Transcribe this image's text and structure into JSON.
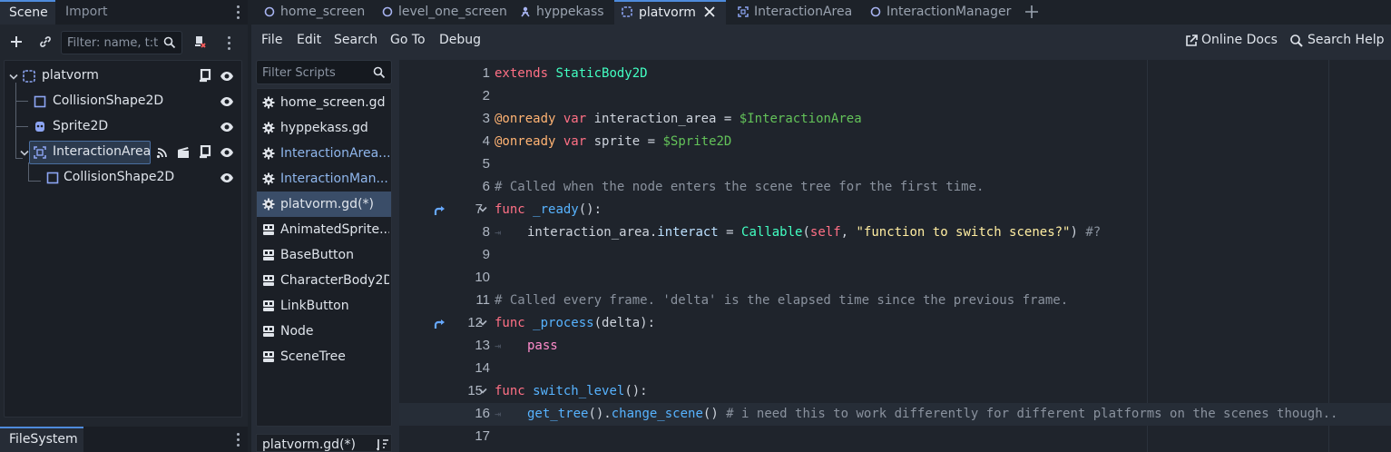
{
  "left_dock": {
    "tabs": [
      "Scene",
      "Import"
    ],
    "filter_placeholder": "Filter: name, t:t",
    "tree": [
      {
        "label": "platvorm",
        "icon": "static-body-icon"
      },
      {
        "label": "CollisionShape2D",
        "icon": "collision-shape-icon"
      },
      {
        "label": "Sprite2D",
        "icon": "sprite-icon"
      },
      {
        "label": "InteractionArea",
        "icon": "area-icon"
      },
      {
        "label": "CollisionShape2D",
        "icon": "collision-shape-icon"
      }
    ],
    "bottom_tab": "FileSystem"
  },
  "scene_tabs": [
    {
      "label": "home_screen",
      "icon": "circle-icon"
    },
    {
      "label": "level_one_screen",
      "icon": "circle-icon"
    },
    {
      "label": "hyppekass",
      "icon": "character-icon"
    },
    {
      "label": "platvorm",
      "icon": "static-body-icon",
      "active": true
    },
    {
      "label": "InteractionArea",
      "icon": "area-icon"
    },
    {
      "label": "InteractionManager",
      "icon": "circle-icon"
    }
  ],
  "menu": {
    "items": [
      "File",
      "Edit",
      "Search",
      "Go To",
      "Debug"
    ],
    "online_docs": "Online Docs",
    "search_help": "Search Help"
  },
  "scripts": {
    "filter_placeholder": "Filter Scripts",
    "items": [
      {
        "label": "home_screen.gd",
        "kind": "gear"
      },
      {
        "label": "hyppekass.gd",
        "kind": "gear"
      },
      {
        "label": "InteractionArea...",
        "kind": "gear",
        "blue": true
      },
      {
        "label": "InteractionMan...",
        "kind": "gear",
        "blue": true
      },
      {
        "label": "platvorm.gd(*)",
        "kind": "gear",
        "selected": true
      },
      {
        "label": "AnimatedSprite...",
        "kind": "doc"
      },
      {
        "label": "BaseButton",
        "kind": "doc"
      },
      {
        "label": "CharacterBody2D",
        "kind": "doc"
      },
      {
        "label": "LinkButton",
        "kind": "doc"
      },
      {
        "label": "Node",
        "kind": "doc"
      },
      {
        "label": "SceneTree",
        "kind": "doc"
      }
    ],
    "current_file": "platvorm.gd(*)"
  },
  "code": {
    "line_numbers": [
      "1",
      "2",
      "3",
      "4",
      "5",
      "6",
      "7",
      "8",
      "9",
      "10",
      "11",
      "12",
      "13",
      "14",
      "15",
      "16",
      "17"
    ],
    "lines": {
      "l1_kw": "extends",
      "l1_cls": "StaticBody2D",
      "l3_ann": "@onready",
      "l3_kw": "var",
      "l3_name": "interaction_area",
      "l3_eq": "=",
      "l3_path": "$InteractionArea",
      "l4_ann": "@onready",
      "l4_kw": "var",
      "l4_name": "sprite",
      "l4_eq": "=",
      "l4_path": "$Sprite2D",
      "l6_cmt": "# Called when the node enters the scene tree for the first time.",
      "l7_kw": "func",
      "l7_fn": "_ready",
      "l7_rest": "():",
      "l8_obj": "interaction_area",
      "l8_dot": ".",
      "l8_prop": "interact",
      "l8_eq": " = ",
      "l8_cls": "Callable",
      "l8_open": "(",
      "l8_self": "self",
      "l8_comma": ", ",
      "l8_str": "\"function to switch scenes?\"",
      "l8_close": ")",
      "l8_cmt": " #?",
      "l11_cmt": "# Called every frame. 'delta' is the elapsed time since the previous frame.",
      "l12_kw": "func",
      "l12_fn": "_process",
      "l12_rest": "(delta):",
      "l13_kw": "pass",
      "l15_kw": "func",
      "l15_fn": "switch_level",
      "l15_rest": "():",
      "l16_fn1": "get_tree",
      "l16_mid": "().",
      "l16_fn2": "change_scene",
      "l16_end": "()",
      "l16_cmt": " # i need this to work differently for different platforms on the scenes though.."
    }
  }
}
